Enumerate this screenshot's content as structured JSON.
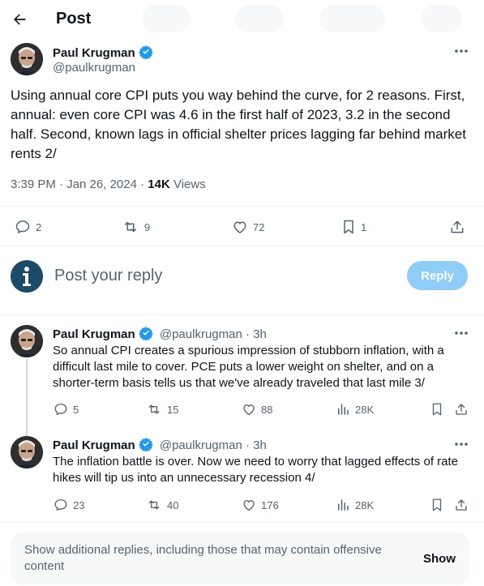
{
  "header": {
    "title": "Post"
  },
  "main_post": {
    "author_name": "Paul Krugman",
    "author_handle": "@paulkrugman",
    "text": "Using annual core CPI puts you way behind the curve, for 2 reasons. First, annual: even core CPI was 4.6 in the first half of 2023, 3.2 in the second half. Second, known lags in official shelter prices lagging far behind market rents 2/",
    "time": "3:39 PM · Jan 26, 2024 · ",
    "views_count": "14K",
    "views_label": " Views",
    "replies": "2",
    "reposts": "9",
    "likes": "72",
    "bookmarks": "1"
  },
  "reply_box": {
    "placeholder": "Post your reply",
    "button_label": "Reply"
  },
  "replies": [
    {
      "author_name": "Paul Krugman",
      "author_handle": "@paulkrugman",
      "age": "· 3h",
      "text": "So annual CPI creates a spurious impression of stubborn inflation, with a difficult last mile to cover. PCE puts a lower weight on shelter, and on a shorter-term basis tells us that we've already traveled that last mile 3/",
      "replies": "5",
      "reposts": "15",
      "likes": "88",
      "views": "28K"
    },
    {
      "author_name": "Paul Krugman",
      "author_handle": "@paulkrugman",
      "age": "· 3h",
      "text": "The inflation battle is over. Now we need to worry that lagged effects of rate hikes will tip us into an unnecessary recession 4/",
      "replies": "23",
      "reposts": "40",
      "likes": "176",
      "views": "28K"
    }
  ],
  "more_replies": {
    "text": "Show additional replies, including those that may contain offensive content",
    "button_label": "Show"
  },
  "colors": {
    "accent": "#1d9bf0",
    "reply_button_disabled": "#8ecdf8",
    "secondary_text": "#536471",
    "info_icon": "#1b4b6b"
  },
  "icons": [
    "back-arrow-icon",
    "verified-badge-icon",
    "more-icon",
    "reply-icon",
    "repost-icon",
    "like-icon",
    "bookmark-icon",
    "share-icon",
    "views-icon",
    "info-icon"
  ]
}
